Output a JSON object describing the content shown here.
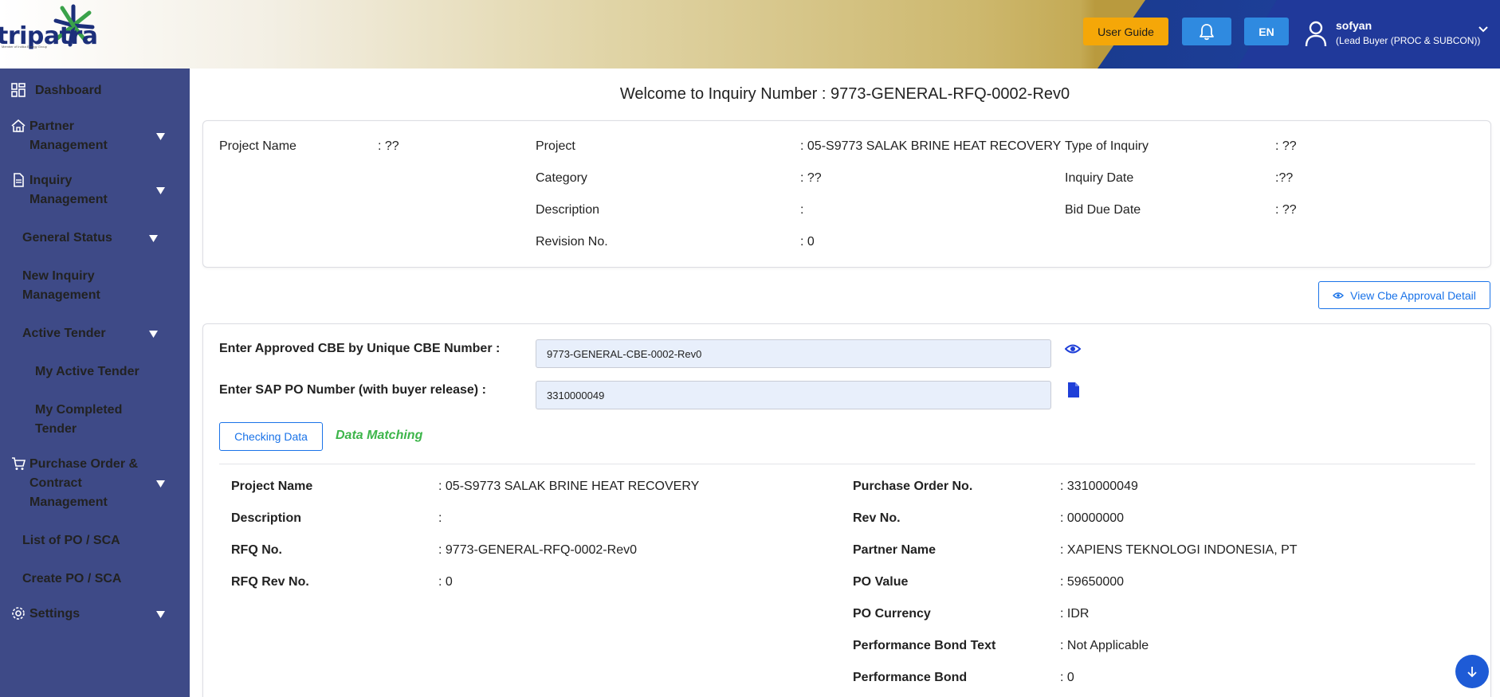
{
  "header": {
    "logo_text": "tripatra",
    "logo_tagline": "Member of Indika Energy Group",
    "user_guide_label": "User Guide",
    "language_label": "EN",
    "user_name": "sofyan",
    "user_role": "(Lead Buyer (PROC & SUBCON))"
  },
  "sidebar": {
    "items": [
      {
        "label": "Dashboard"
      },
      {
        "label_line1": "Partner",
        "label_line2": "Management"
      },
      {
        "label_line1": "Inquiry",
        "label_line2": "Management"
      },
      {
        "label": "General Status"
      },
      {
        "label_line1": "New Inquiry",
        "label_line2": "Management"
      },
      {
        "label": "Active Tender"
      },
      {
        "label": "My Active Tender"
      },
      {
        "label_line1": "My Completed",
        "label_line2": "Tender"
      },
      {
        "label_line1": "Purchase Order &",
        "label_line2": "Contract",
        "label_line3": "Management"
      },
      {
        "label": "List of PO / SCA"
      },
      {
        "label": "Create PO / SCA"
      },
      {
        "label": "Settings"
      }
    ]
  },
  "main": {
    "welcome": "Welcome to Inquiry Number : 9773-GENERAL-RFQ-0002-Rev0",
    "info": {
      "project_name_label": "Project Name",
      "project_name_value": ": ??",
      "project_label": "Project",
      "project_value": ": 05-S9773 SALAK BRINE HEAT RECOVERY",
      "category_label": "Category",
      "category_value": ": ??",
      "description_label": "Description",
      "description_value": ":",
      "revision_label": "Revision No.",
      "revision_value": ": 0",
      "type_label": "Type of Inquiry",
      "type_value": ": ??",
      "inquiry_date_label": "Inquiry Date",
      "inquiry_date_value": ":??",
      "bid_due_label": "Bid Due Date",
      "bid_due_value": ": ??"
    },
    "view_cbe_button": "View Cbe Approval Detail",
    "cbe_label": "Enter Approved CBE by Unique CBE Number :",
    "cbe_value": "9773-GENERAL-CBE-0002-Rev0",
    "po_label": "Enter SAP PO Number (with buyer release) :",
    "po_value": "3310000049",
    "checking_button": "Checking Data",
    "match_status": "Data Matching",
    "details_left": [
      {
        "label": "Project Name",
        "value": ": 05-S9773 SALAK BRINE HEAT RECOVERY"
      },
      {
        "label": "Description",
        "value": ":"
      },
      {
        "label": "RFQ No.",
        "value": ": 9773-GENERAL-RFQ-0002-Rev0"
      },
      {
        "label": "RFQ Rev No.",
        "value": ": 0"
      }
    ],
    "details_right": [
      {
        "label": "Purchase Order No.",
        "value": ": 3310000049"
      },
      {
        "label": "Rev No.",
        "value": ": 00000000"
      },
      {
        "label": "Partner Name",
        "value": ": XAPIENS TEKNOLOGI INDONESIA, PT"
      },
      {
        "label": "PO Value",
        "value": ": 59650000"
      },
      {
        "label": "PO Currency",
        "value": ": IDR"
      },
      {
        "label": "Performance Bond Text",
        "value": ": Not Applicable"
      },
      {
        "label": "Performance Bond",
        "value": ": 0"
      }
    ]
  },
  "colors": {
    "sidebar_bg": "#3e4a87",
    "header_blue": "#1e3f9a",
    "accent_orange": "#f5a708",
    "button_blue": "#2f8ae0",
    "link_blue": "#1a73e8",
    "success_green": "#3db54a"
  }
}
